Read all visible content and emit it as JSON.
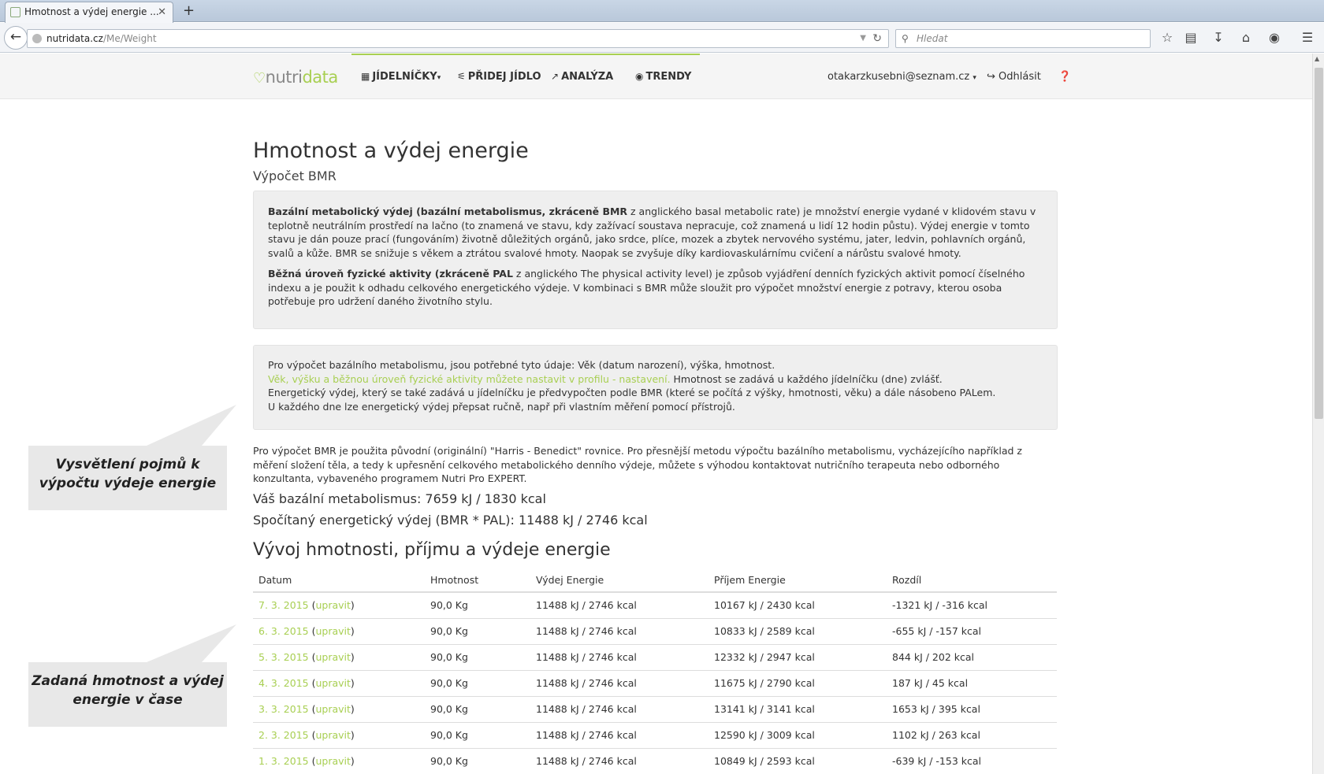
{
  "browser": {
    "tab_title": "Hmotnost a výdej energie ...",
    "tab_close": "✕",
    "new_tab": "+",
    "url_domain": "nutridata.cz",
    "url_path": "/Me/Weight",
    "search_placeholder": "Hledat"
  },
  "header": {
    "logo_part1": "nutri",
    "logo_part2": "data",
    "menu": [
      {
        "label": "JÍDELNÍČKY",
        "icon": "calendar-icon"
      },
      {
        "label": "PŘIDEJ JÍDLO",
        "icon": "cutlery-icon"
      },
      {
        "label": "ANALÝZA",
        "icon": "chart-icon"
      },
      {
        "label": "TRENDY",
        "icon": "dashboard-icon"
      }
    ],
    "user_email": "otakarzkusebni@seznam.cz",
    "logout": "Odhlásit"
  },
  "main": {
    "title": "Hmotnost a výdej energie",
    "subtitle": "Výpočet BMR",
    "info1": {
      "p1_bold": "Bazální metabolický výdej (bazální metabolismus, zkráceně BMR",
      "p1_text": " z anglického basal metabolic rate) je množství energie vydané v klidovém stavu v teplotně neutrálním prostředí na lačno (to znamená ve stavu, kdy zažívací soustava nepracuje, což znamená u lidí 12 hodin půstu). Výdej energie v tomto stavu je dán pouze prací (fungováním) životně důležitých orgánů, jako srdce, plíce, mozek a zbytek nervového systému, jater, ledvin, pohlavních orgánů, svalů a kůže. BMR se snižuje s věkem a ztrátou svalové hmoty. Naopak se zvyšuje díky kardiovaskulárnímu cvičení a nárůstu svalové hmoty.",
      "p2_bold": "Běžná úroveň fyzické aktivity (zkráceně PAL",
      "p2_text": " z anglického The physical activity level) je způsob vyjádření denních fyzických aktivit pomocí číselného indexu a je použit k odhadu celkového energetického výdeje. V kombinaci s BMR může sloužit pro výpočet množství energie z potravy, kterou osoba potřebuje pro udržení daného životního stylu."
    },
    "info2": {
      "line1": "Pro výpočet bazálního metabolismu, jsou potřebné tyto údaje: Věk (datum narození), výška, hmotnost.",
      "line2_link": "Věk, výšku a běžnou úroveň fyzické aktivity můžete nastavit v profilu - nastavení.",
      "line2_text": " Hmotnost se zadává u každého jídelníčku (dne) zvlášť.",
      "line3": "Energetický výdej, který se také zadává u jídelníčku je předvypočten podle BMR (které se počítá z výšky, hmotnosti, věku) a dále násobeno PALem.",
      "line4": "U každého dne lze energetický výdej přepsat ručně, např při vlastním měření pomocí přístrojů."
    },
    "paragraph": "Pro výpočet BMR je použita původní (originální) \"Harris - Benedict\" rovnice. Pro přesnější metodu výpočtu bazálního metabolismu, vycházejícího například z měření složení těla, a tedy k upřesnění celkového metabolického denního výdeje, můžete s výhodou kontaktovat nutričního terapeuta nebo odborného konzultanta, vybaveného programem Nutri Pro EXPERT.",
    "bmr": "Váš bazální metabolismus: 7659 kJ / 1830 kcal",
    "expenditure": "Spočítaný energetický výdej (BMR * PAL): 11488 kJ / 2746 kcal",
    "section_title": "Vývoj hmotnosti, příjmu a výdeje energie"
  },
  "table": {
    "headers": [
      "Datum",
      "Hmotnost",
      "Výdej Energie",
      "Příjem Energie",
      "Rozdíl"
    ],
    "edit_label": "upravit",
    "rows": [
      {
        "date": "7. 3. 2015",
        "weight": "90,0 Kg",
        "out": "11488 kJ / 2746 kcal",
        "in": "10167 kJ / 2430 kcal",
        "diff": "-1321 kJ / -316 kcal"
      },
      {
        "date": "6. 3. 2015",
        "weight": "90,0 Kg",
        "out": "11488 kJ / 2746 kcal",
        "in": "10833 kJ / 2589 kcal",
        "diff": "-655 kJ / -157 kcal"
      },
      {
        "date": "5. 3. 2015",
        "weight": "90,0 Kg",
        "out": "11488 kJ / 2746 kcal",
        "in": "12332 kJ / 2947 kcal",
        "diff": "844 kJ / 202 kcal"
      },
      {
        "date": "4. 3. 2015",
        "weight": "90,0 Kg",
        "out": "11488 kJ / 2746 kcal",
        "in": "11675 kJ / 2790 kcal",
        "diff": "187 kJ / 45 kcal"
      },
      {
        "date": "3. 3. 2015",
        "weight": "90,0 Kg",
        "out": "11488 kJ / 2746 kcal",
        "in": "13141 kJ / 3141 kcal",
        "diff": "1653 kJ / 395 kcal"
      },
      {
        "date": "2. 3. 2015",
        "weight": "90,0 Kg",
        "out": "11488 kJ / 2746 kcal",
        "in": "12590 kJ / 3009 kcal",
        "diff": "1102 kJ / 263 kcal"
      },
      {
        "date": "1. 3. 2015",
        "weight": "90,0 Kg",
        "out": "11488 kJ / 2746 kcal",
        "in": "10849 kJ / 2593 kcal",
        "diff": "-639 kJ / -153 kcal"
      }
    ]
  },
  "callouts": {
    "c1": "Vysvětlení pojmů k výpočtu výdeje energie",
    "c2": "Zadaná hmotnost a výdej energie v čase"
  },
  "colors": {
    "accent_green": "#a8cf52"
  }
}
